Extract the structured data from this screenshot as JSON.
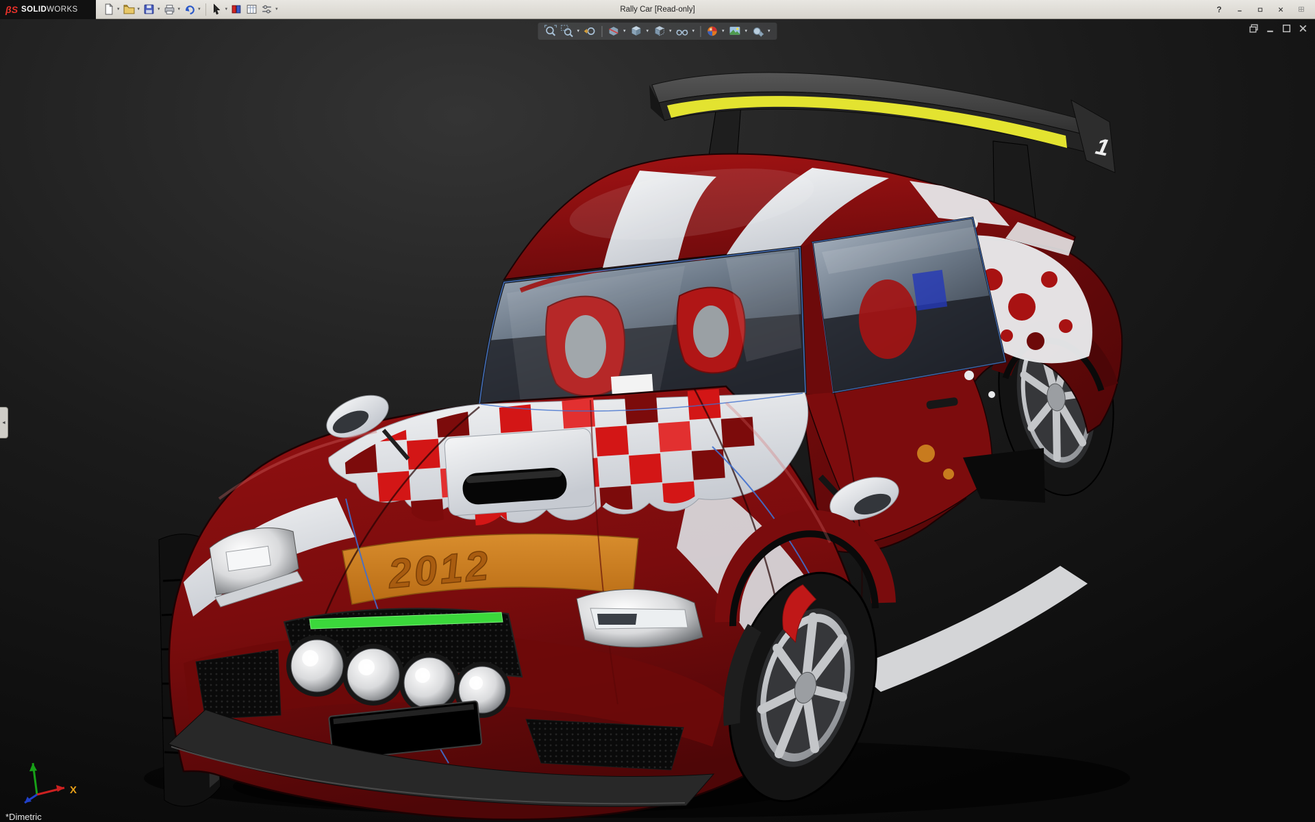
{
  "window": {
    "brand_mark": "βS",
    "brand_prefix": "SOLID",
    "brand_suffix": "WORKS",
    "title": "Rally Car [Read-only]",
    "help_glyph": "?"
  },
  "titlebar": {
    "dropdown_glyph": "▾",
    "tools": [
      "new-document",
      "open",
      "save",
      "print",
      "undo",
      "select",
      "color-swatch",
      "design-table",
      "options"
    ],
    "window_buttons": [
      "help",
      "minimize",
      "restore",
      "close",
      "layout-grid"
    ]
  },
  "heads_up": {
    "tools": [
      "zoom-to-fit",
      "zoom-to-area",
      "previous-view",
      "section-view",
      "view-orientation",
      "display-style",
      "hide-show-items",
      "edit-appearance",
      "apply-scene",
      "view-settings"
    ]
  },
  "mdi": {
    "buttons": [
      "restore-window",
      "minimize-window",
      "maximize-window",
      "close-window"
    ]
  },
  "viewport": {
    "orientation_label": "*Dimetric",
    "collapse_glyph": "◄"
  },
  "car": {
    "hood_year": "2012",
    "wing_number": "1"
  },
  "triad": {
    "x_label": "X"
  },
  "colors": {
    "body_red": "#8e0f10",
    "body_dark": "#4c0607",
    "stripe_white": "#ededee",
    "band_orange": "#c97c1f",
    "year_orange": "#a85c10",
    "wing_yellow": "#e3e330",
    "accent_green": "#3bd83b",
    "glass_blue": "#76839a",
    "background": "#141414"
  }
}
